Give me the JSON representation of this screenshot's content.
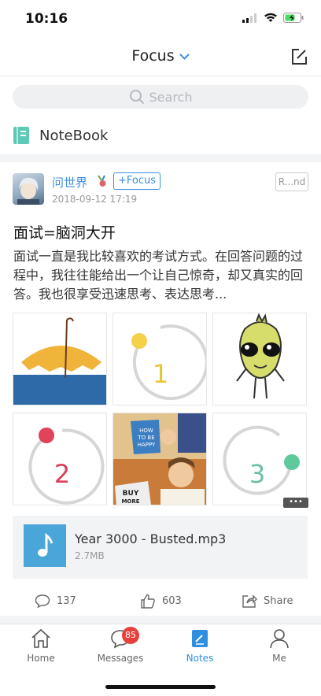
{
  "status": {
    "time": "10:16"
  },
  "nav": {
    "title": "Focus"
  },
  "search": {
    "placeholder": "Search"
  },
  "notebook": {
    "label": "NoteBook"
  },
  "post": {
    "author": "问世界",
    "focus_label": "+Focus",
    "ribbon_label": "R...nd",
    "date": "2018-09-12 17:19",
    "title": "面试=脑洞大开",
    "body": "面试一直是我比较喜欢的考试方式。在回答问题的过程中，我往往能给出一个让自己惊奇，却又真实的回答。我也很享受迅速思考、表达思考...",
    "images": [
      {
        "icon": "umbrella-image"
      },
      {
        "number": "1"
      },
      {
        "icon": "alien-image"
      },
      {
        "number": "2"
      },
      {
        "book_text": [
          "HOW",
          "TO BE",
          "HAPPY"
        ],
        "sign_text": [
          "BUY",
          "MORE"
        ]
      },
      {
        "number": "3"
      }
    ],
    "more_indicator": "•••",
    "attachment": {
      "name": "Year 3000 - Busted.mp3",
      "size": "2.7MB"
    },
    "actions": {
      "comments": "137",
      "likes": "603",
      "share": "Share"
    }
  },
  "tabs": [
    {
      "label": "Home",
      "icon": "home-icon"
    },
    {
      "label": "Messages",
      "icon": "messages-icon",
      "badge": "85"
    },
    {
      "label": "Notes",
      "icon": "notes-icon"
    },
    {
      "label": "Me",
      "icon": "person-icon"
    }
  ],
  "colors": {
    "accent": "#2f8ee0",
    "badge": "#e8413b",
    "notebook_icon": "#5fc9b8"
  }
}
